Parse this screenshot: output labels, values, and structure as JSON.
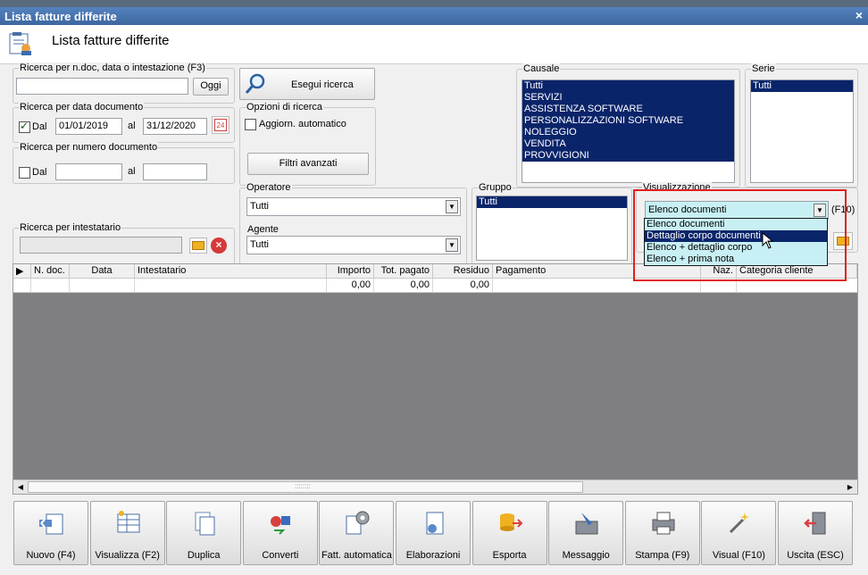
{
  "window": {
    "title": "Lista fatture differite",
    "close_glyph": "×"
  },
  "header": {
    "title": "Lista fatture differite",
    "icon": "invoice-list-icon"
  },
  "search_text": {
    "label": "Ricerca per n.doc, data o intestazione (F3)",
    "value": "",
    "button": "Oggi"
  },
  "search_button": {
    "label": "Esegui ricerca",
    "icon": "magnifier-icon"
  },
  "date_search": {
    "label": "Ricerca per data documento",
    "from_label": "Dal",
    "from_checked": true,
    "from_value": "01/01/2019",
    "to_label": "al",
    "to_value": "31/12/2020",
    "calendar_badge": "24"
  },
  "number_search": {
    "label": "Ricerca per numero documento",
    "from_label": "Dal",
    "from_checked": false,
    "from_value": "",
    "to_label": "al",
    "to_value": ""
  },
  "options": {
    "label": "Opzioni di ricerca",
    "auto_update_label": "Aggiorn. automatico",
    "auto_update_checked": false,
    "advanced_filters": "Filtri avanzati"
  },
  "causale": {
    "label": "Causale",
    "items": [
      "Tutti",
      "SERVIZI",
      "ASSISTENZA SOFTWARE",
      "PERSONALIZZAZIONI SOFTWARE",
      "NOLEGGIO",
      "VENDITA",
      "PROVVIGIONI"
    ]
  },
  "serie": {
    "label": "Serie",
    "items": [
      "Tutti"
    ]
  },
  "operatore": {
    "label": "Operatore",
    "value": "Tutti"
  },
  "agente": {
    "label": "Agente",
    "value": "Tutti"
  },
  "gruppo": {
    "label": "Gruppo",
    "items": [
      "Tutti"
    ]
  },
  "intestatario": {
    "label": "Ricerca per intestatario",
    "value": ""
  },
  "visualizzazione": {
    "label": "Visualizzazione",
    "value": "Elenco documenti",
    "shortcut": "(F10)",
    "options": [
      "Elenco documenti",
      "Dettaglio corpo documenti",
      "Elenco + dettaglio corpo",
      "Elenco + prima nota"
    ],
    "highlighted_index": 1,
    "highlight_color": "#e02020"
  },
  "grid": {
    "columns": [
      "N. doc.",
      "Data",
      "Intestatario",
      "Importo",
      "Tot. pagato",
      "Residuo",
      "Pagamento",
      "Naz.",
      "Categoria cliente"
    ],
    "totals": {
      "importo": "0,00",
      "tot_pagato": "0,00",
      "residuo": "0,00"
    },
    "scroll_grip": "::::::::"
  },
  "toolbar": [
    {
      "label": "Nuovo (F4)",
      "icon": "new-document-icon"
    },
    {
      "label": "Visualizza (F2)",
      "icon": "view-table-icon"
    },
    {
      "label": "Duplica",
      "icon": "duplicate-icon"
    },
    {
      "label": "Converti",
      "icon": "convert-icon"
    },
    {
      "label": "Fatt. automatica",
      "icon": "auto-invoice-gear-icon"
    },
    {
      "label": "Elaborazioni",
      "icon": "processing-icon"
    },
    {
      "label": "Esporta",
      "icon": "export-icon"
    },
    {
      "label": "Messaggio",
      "icon": "message-icon"
    },
    {
      "label": "Stampa (F9)",
      "icon": "printer-icon"
    },
    {
      "label": "Visual (F10)",
      "icon": "magic-wand-icon"
    },
    {
      "label": "Uscita (ESC)",
      "icon": "exit-door-icon"
    }
  ]
}
